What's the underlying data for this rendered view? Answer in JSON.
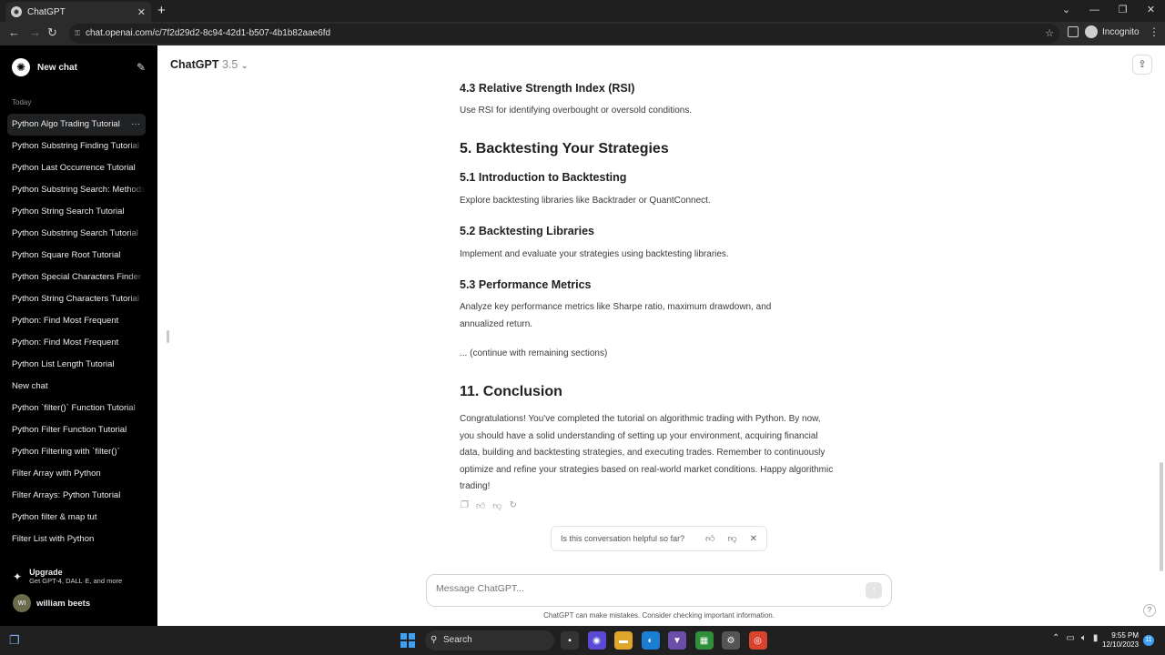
{
  "browser": {
    "tab_title": "ChatGPT",
    "url": "chat.openai.com/c/7f2d29d2-8c94-42d1-b507-4b1b82aae6fd",
    "profile": "Incognito"
  },
  "sidebar": {
    "new_chat": "New chat",
    "section_label": "Today",
    "items": [
      {
        "label": "Python Algo Trading Tutorial"
      },
      {
        "label": "Python Substring Finding Tutorial"
      },
      {
        "label": "Python Last Occurrence Tutorial"
      },
      {
        "label": "Python Substring Search: Methods"
      },
      {
        "label": "Python String Search Tutorial"
      },
      {
        "label": "Python Substring Search Tutorial"
      },
      {
        "label": "Python Square Root Tutorial"
      },
      {
        "label": "Python Special Characters Finder"
      },
      {
        "label": "Python String Characters Tutorial"
      },
      {
        "label": "Python: Find Most Frequent"
      },
      {
        "label": "Python: Find Most Frequent"
      },
      {
        "label": "Python List Length Tutorial"
      },
      {
        "label": "New chat"
      },
      {
        "label": "Python `filter()` Function Tutorial"
      },
      {
        "label": "Python Filter Function Tutorial"
      },
      {
        "label": "Python Filtering with `filter()`"
      },
      {
        "label": "Filter Array with Python"
      },
      {
        "label": "Filter Arrays: Python Tutorial"
      },
      {
        "label": "Python filter & map tut"
      },
      {
        "label": "Filter List with Python"
      }
    ],
    "upgrade_title": "Upgrade",
    "upgrade_subtitle": "Get GPT-4, DALL·E, and more",
    "user_initials": "WI",
    "user_name": "william beets"
  },
  "header": {
    "model_name": "ChatGPT",
    "model_version": "3.5"
  },
  "content": {
    "h_4_3": "4.3 Relative Strength Index (RSI)",
    "p_4_3": "Use RSI for identifying overbought or oversold conditions.",
    "h_5": "5. Backtesting Your Strategies",
    "h_5_1": "5.1 Introduction to Backtesting",
    "p_5_1": "Explore backtesting libraries like Backtrader or QuantConnect.",
    "h_5_2": "5.2 Backtesting Libraries",
    "p_5_2": "Implement and evaluate your strategies using backtesting libraries.",
    "h_5_3": "5.3 Performance Metrics",
    "p_5_3": "Analyze key performance metrics like Sharpe ratio, maximum drawdown, and annualized return.",
    "p_continue": "... (continue with remaining sections)",
    "h_11": "11. Conclusion",
    "p_11": "Congratulations! You've completed the tutorial on algorithmic trading with Python. By now, you should have a solid understanding of setting up your environment, acquiring financial data, building and backtesting strategies, and executing trades. Remember to continuously optimize and refine your strategies based on real-world market conditions. Happy algorithmic trading!"
  },
  "feedback": {
    "question": "Is this conversation helpful so far?"
  },
  "composer": {
    "placeholder": "Message ChatGPT...",
    "disclaimer": "ChatGPT can make mistakes. Consider checking important information."
  },
  "taskbar": {
    "search_label": "Search",
    "time": "9:55 PM",
    "date": "12/10/2023",
    "notification_count": "11"
  }
}
